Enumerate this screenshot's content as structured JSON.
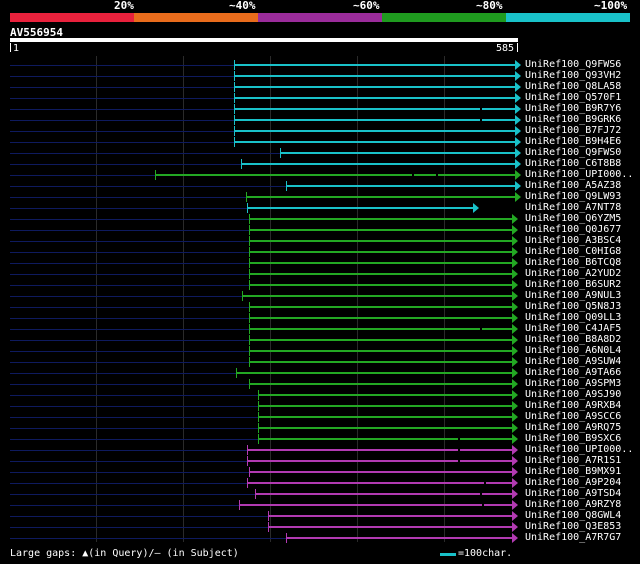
{
  "header": {
    "percent_labels": [
      "20%",
      "~40%",
      "~60%",
      "~80%",
      "~100%"
    ],
    "color_segments": [
      "#e8213c",
      "#e86c1c",
      "#9b2c9b",
      "#1f9b1f",
      "#19c1c9"
    ]
  },
  "query": {
    "id": "AV556954",
    "start": "1",
    "end": "585"
  },
  "colors": {
    "cyan": "#19c1c9",
    "green": "#23a823",
    "magenta": "#b23ab2",
    "faint": "#0e1a5e"
  },
  "hits": [
    {
      "label": "UniRef100_Q9FWS6",
      "color": "cyan"
    },
    {
      "label": "UniRef100_Q93VH2",
      "color": "cyan"
    },
    {
      "label": "UniRef100_Q8LA58",
      "color": "cyan"
    },
    {
      "label": "UniRef100_Q570F1",
      "color": "cyan"
    },
    {
      "label": "UniRef100_B9R7Y6",
      "color": "cyan"
    },
    {
      "label": "UniRef100_B9GRK6",
      "color": "cyan"
    },
    {
      "label": "UniRef100_B7FJ72",
      "color": "cyan"
    },
    {
      "label": "UniRef100_B9H4E6",
      "color": "cyan"
    },
    {
      "label": "UniRef100_Q9FWS0",
      "color": "cyan"
    },
    {
      "label": "UniRef100_C6T8B8",
      "color": "cyan"
    },
    {
      "label": "UniRef100_UPI000..",
      "color": "green"
    },
    {
      "label": "UniRef100_A5AZ38",
      "color": "cyan"
    },
    {
      "label": "UniRef100_Q9LW93",
      "color": "green"
    },
    {
      "label": "UniRef100_A7NT78",
      "color": "cyan"
    },
    {
      "label": "UniRef100_Q6YZM5",
      "color": "green"
    },
    {
      "label": "UniRef100_Q0J677",
      "color": "green"
    },
    {
      "label": "UniRef100_A3BSC4",
      "color": "green"
    },
    {
      "label": "UniRef100_C0HIG8",
      "color": "green"
    },
    {
      "label": "UniRef100_B6TCQ8",
      "color": "green"
    },
    {
      "label": "UniRef100_A2YUD2",
      "color": "green"
    },
    {
      "label": "UniRef100_B6SUR2",
      "color": "green"
    },
    {
      "label": "UniRef100_A9NUL3",
      "color": "green"
    },
    {
      "label": "UniRef100_Q5N8J3",
      "color": "green"
    },
    {
      "label": "UniRef100_Q09LL3",
      "color": "green"
    },
    {
      "label": "UniRef100_C4JAF5",
      "color": "green"
    },
    {
      "label": "UniRef100_B8A8D2",
      "color": "green"
    },
    {
      "label": "UniRef100_A6N0L4",
      "color": "green"
    },
    {
      "label": "UniRef100_A9SUW4",
      "color": "green"
    },
    {
      "label": "UniRef100_A9TA66",
      "color": "green"
    },
    {
      "label": "UniRef100_A9SPM3",
      "color": "green"
    },
    {
      "label": "UniRef100_A9SJ90",
      "color": "green"
    },
    {
      "label": "UniRef100_A9RXB4",
      "color": "green"
    },
    {
      "label": "UniRef100_A9SCC6",
      "color": "green"
    },
    {
      "label": "UniRef100_A9RQ75",
      "color": "green"
    },
    {
      "label": "UniRef100_B9SXC6",
      "color": "green"
    },
    {
      "label": "UniRef100_UPI000..",
      "color": "magenta"
    },
    {
      "label": "UniRef100_A7R1S1",
      "color": "magenta"
    },
    {
      "label": "UniRef100_B9MX91",
      "color": "magenta"
    },
    {
      "label": "UniRef100_A9P204",
      "color": "magenta"
    },
    {
      "label": "UniRef100_A9TSD4",
      "color": "magenta"
    },
    {
      "label": "UniRef100_A9RZY8",
      "color": "magenta"
    },
    {
      "label": "UniRef100_Q8GWL4",
      "color": "magenta"
    },
    {
      "label": "UniRef100_Q3E853",
      "color": "magenta"
    },
    {
      "label": "UniRef100_A7R7G7",
      "color": "magenta"
    }
  ],
  "footer": {
    "large_gaps": "Large gaps: ▲(in Query)/– (in Subject)",
    "legend": "=100char."
  }
}
